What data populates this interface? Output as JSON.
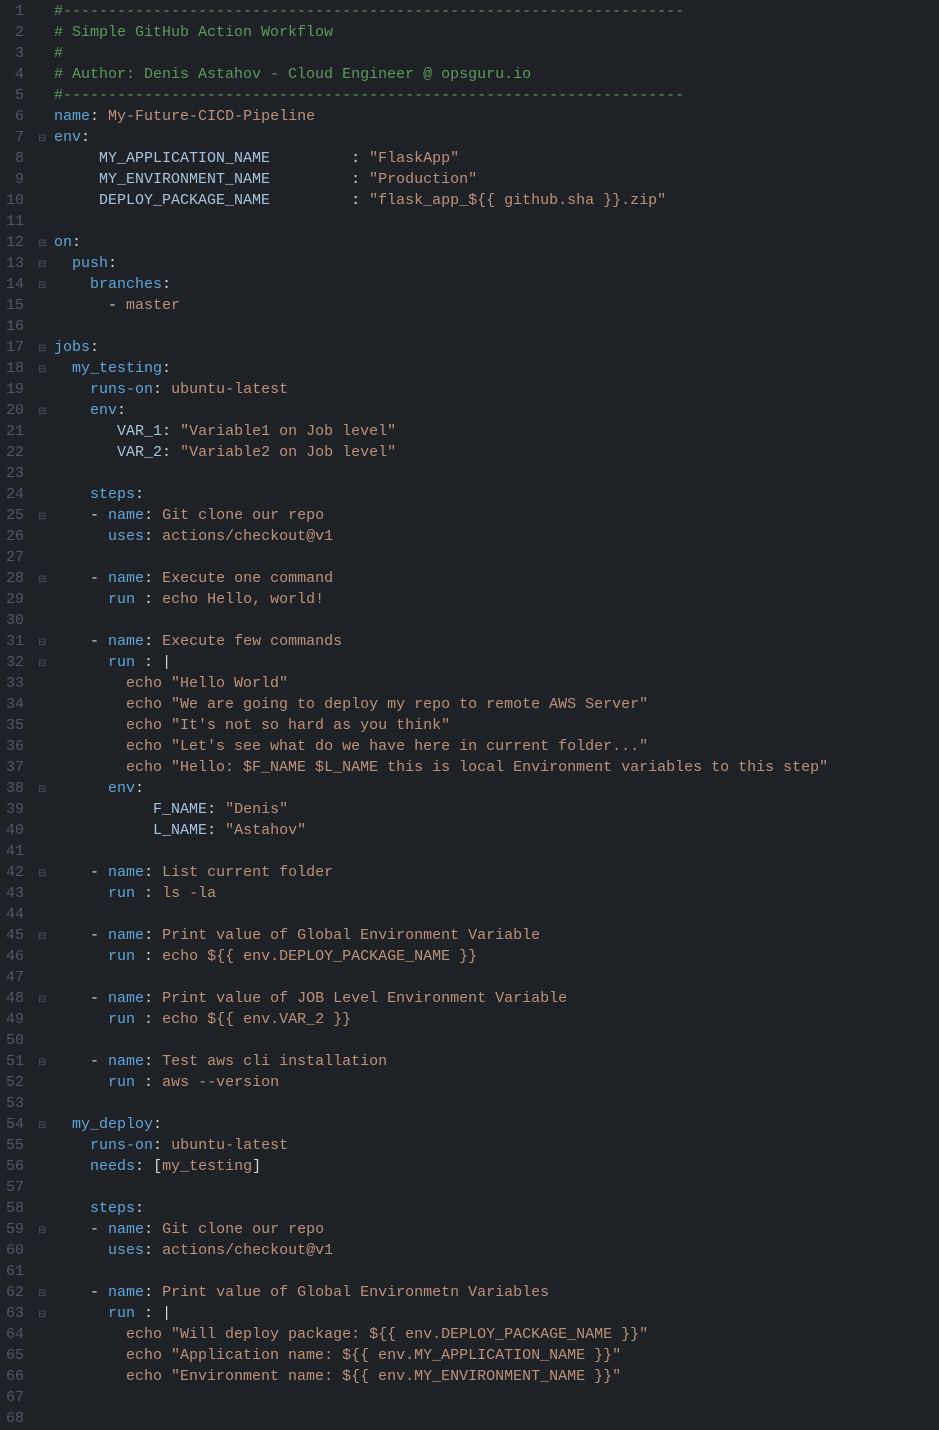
{
  "lines": [
    {
      "n": 1,
      "fold": "",
      "tokens": [
        [
          "c-comment",
          "#---------------------------------------------------------------------"
        ]
      ]
    },
    {
      "n": 2,
      "fold": "",
      "tokens": [
        [
          "c-comment",
          "# Simple GitHub Action Workflow"
        ]
      ]
    },
    {
      "n": 3,
      "fold": "",
      "tokens": [
        [
          "c-comment",
          "#"
        ]
      ]
    },
    {
      "n": 4,
      "fold": "",
      "tokens": [
        [
          "c-comment",
          "# Author: Denis Astahov - Cloud Engineer @ opsguru.io"
        ]
      ]
    },
    {
      "n": 5,
      "fold": "",
      "tokens": [
        [
          "c-comment",
          "#---------------------------------------------------------------------"
        ]
      ]
    },
    {
      "n": 6,
      "fold": "",
      "tokens": [
        [
          "c-keywd",
          "name"
        ],
        [
          "c-op",
          ": "
        ],
        [
          "c-string",
          "My-Future-CICD-Pipeline"
        ]
      ]
    },
    {
      "n": 7,
      "fold": "⊟",
      "tokens": [
        [
          "c-keywd",
          "env"
        ],
        [
          "c-op",
          ":"
        ]
      ]
    },
    {
      "n": 8,
      "fold": "",
      "tokens": [
        [
          "",
          "     "
        ],
        [
          "c-ident",
          "MY_APPLICATION_NAME"
        ],
        [
          "",
          "         "
        ],
        [
          "c-op",
          ": "
        ],
        [
          "c-string",
          "\"FlaskApp\""
        ]
      ]
    },
    {
      "n": 9,
      "fold": "",
      "tokens": [
        [
          "",
          "     "
        ],
        [
          "c-ident",
          "MY_ENVIRONMENT_NAME"
        ],
        [
          "",
          "         "
        ],
        [
          "c-op",
          ": "
        ],
        [
          "c-string",
          "\"Production\""
        ]
      ]
    },
    {
      "n": 10,
      "fold": "",
      "tokens": [
        [
          "",
          "     "
        ],
        [
          "c-ident",
          "DEPLOY_PACKAGE_NAME"
        ],
        [
          "",
          "         "
        ],
        [
          "c-op",
          ": "
        ],
        [
          "c-string",
          "\"flask_app_${{ github.sha }}.zip\""
        ]
      ]
    },
    {
      "n": 11,
      "fold": "",
      "tokens": []
    },
    {
      "n": 12,
      "fold": "⊟",
      "tokens": [
        [
          "c-keywd",
          "on"
        ],
        [
          "c-op",
          ":"
        ]
      ]
    },
    {
      "n": 13,
      "fold": "⊟",
      "tokens": [
        [
          "",
          "  "
        ],
        [
          "c-keywd",
          "push"
        ],
        [
          "c-op",
          ":"
        ]
      ]
    },
    {
      "n": 14,
      "fold": "⊟",
      "tokens": [
        [
          "",
          "    "
        ],
        [
          "c-keywd",
          "branches"
        ],
        [
          "c-op",
          ":"
        ]
      ]
    },
    {
      "n": 15,
      "fold": "",
      "tokens": [
        [
          "",
          "      "
        ],
        [
          "c-dash",
          "- "
        ],
        [
          "c-string",
          "master"
        ]
      ]
    },
    {
      "n": 16,
      "fold": "",
      "tokens": []
    },
    {
      "n": 17,
      "fold": "⊟",
      "tokens": [
        [
          "c-keywd",
          "jobs"
        ],
        [
          "c-op",
          ":"
        ]
      ]
    },
    {
      "n": 18,
      "fold": "⊟",
      "tokens": [
        [
          "",
          "  "
        ],
        [
          "c-keywd",
          "my_testing"
        ],
        [
          "c-op",
          ":"
        ]
      ]
    },
    {
      "n": 19,
      "fold": "",
      "tokens": [
        [
          "",
          "    "
        ],
        [
          "c-keywd",
          "runs-on"
        ],
        [
          "c-op",
          ": "
        ],
        [
          "c-string",
          "ubuntu-latest"
        ]
      ]
    },
    {
      "n": 20,
      "fold": "⊟",
      "tokens": [
        [
          "",
          "    "
        ],
        [
          "c-keywd",
          "env"
        ],
        [
          "c-op",
          ":"
        ]
      ]
    },
    {
      "n": 21,
      "fold": "",
      "tokens": [
        [
          "",
          "       "
        ],
        [
          "c-ident",
          "VAR_1"
        ],
        [
          "c-op",
          ": "
        ],
        [
          "c-string",
          "\"Variable1 on Job level\""
        ]
      ]
    },
    {
      "n": 22,
      "fold": "",
      "tokens": [
        [
          "",
          "       "
        ],
        [
          "c-ident",
          "VAR_2"
        ],
        [
          "c-op",
          ": "
        ],
        [
          "c-string",
          "\"Variable2 on Job level\""
        ]
      ]
    },
    {
      "n": 23,
      "fold": "",
      "tokens": []
    },
    {
      "n": 24,
      "fold": "",
      "tokens": [
        [
          "",
          "    "
        ],
        [
          "c-keywd",
          "steps"
        ],
        [
          "c-op",
          ":"
        ]
      ]
    },
    {
      "n": 25,
      "fold": "⊟",
      "tokens": [
        [
          "",
          "    "
        ],
        [
          "c-dash",
          "- "
        ],
        [
          "c-keywd",
          "name"
        ],
        [
          "c-op",
          ": "
        ],
        [
          "c-string",
          "Git clone our repo"
        ]
      ]
    },
    {
      "n": 26,
      "fold": "",
      "tokens": [
        [
          "",
          "      "
        ],
        [
          "c-keywd",
          "uses"
        ],
        [
          "c-op",
          ": "
        ],
        [
          "c-string",
          "actions/checkout@v1"
        ]
      ]
    },
    {
      "n": 27,
      "fold": "",
      "tokens": []
    },
    {
      "n": 28,
      "fold": "⊟",
      "tokens": [
        [
          "",
          "    "
        ],
        [
          "c-dash",
          "- "
        ],
        [
          "c-keywd",
          "name"
        ],
        [
          "c-op",
          ": "
        ],
        [
          "c-string",
          "Execute one command"
        ]
      ]
    },
    {
      "n": 29,
      "fold": "",
      "tokens": [
        [
          "",
          "      "
        ],
        [
          "c-keywd",
          "run "
        ],
        [
          "c-op",
          ": "
        ],
        [
          "c-string",
          "echo Hello, world!"
        ]
      ]
    },
    {
      "n": 30,
      "fold": "",
      "tokens": []
    },
    {
      "n": 31,
      "fold": "⊟",
      "tokens": [
        [
          "",
          "    "
        ],
        [
          "c-dash",
          "- "
        ],
        [
          "c-keywd",
          "name"
        ],
        [
          "c-op",
          ": "
        ],
        [
          "c-string",
          "Execute few commands"
        ]
      ]
    },
    {
      "n": 32,
      "fold": "⊟",
      "tokens": [
        [
          "",
          "      "
        ],
        [
          "c-keywd",
          "run "
        ],
        [
          "c-op",
          ": "
        ],
        [
          "c-white",
          "|"
        ]
      ]
    },
    {
      "n": 33,
      "fold": "",
      "tokens": [
        [
          "",
          "        "
        ],
        [
          "c-string",
          "echo \"Hello World\""
        ]
      ]
    },
    {
      "n": 34,
      "fold": "",
      "tokens": [
        [
          "",
          "        "
        ],
        [
          "c-string",
          "echo \"We are going to deploy my repo to remote AWS Server\""
        ]
      ]
    },
    {
      "n": 35,
      "fold": "",
      "tokens": [
        [
          "",
          "        "
        ],
        [
          "c-string",
          "echo \"It's not so hard as you think\""
        ]
      ]
    },
    {
      "n": 36,
      "fold": "",
      "tokens": [
        [
          "",
          "        "
        ],
        [
          "c-string",
          "echo \"Let's see what do we have here in current folder...\""
        ]
      ]
    },
    {
      "n": 37,
      "fold": "",
      "tokens": [
        [
          "",
          "        "
        ],
        [
          "c-string",
          "echo \"Hello: $F_NAME $L_NAME this is local Environment variables to this step\""
        ]
      ]
    },
    {
      "n": 38,
      "fold": "⊟",
      "tokens": [
        [
          "",
          "      "
        ],
        [
          "c-keywd",
          "env"
        ],
        [
          "c-op",
          ":"
        ]
      ]
    },
    {
      "n": 39,
      "fold": "",
      "tokens": [
        [
          "",
          "           "
        ],
        [
          "c-ident",
          "F_NAME"
        ],
        [
          "c-op",
          ": "
        ],
        [
          "c-string",
          "\"Denis\""
        ]
      ]
    },
    {
      "n": 40,
      "fold": "",
      "tokens": [
        [
          "",
          "           "
        ],
        [
          "c-ident",
          "L_NAME"
        ],
        [
          "c-op",
          ": "
        ],
        [
          "c-string",
          "\"Astahov\""
        ]
      ]
    },
    {
      "n": 41,
      "fold": "",
      "tokens": []
    },
    {
      "n": 42,
      "fold": "⊟",
      "tokens": [
        [
          "",
          "    "
        ],
        [
          "c-dash",
          "- "
        ],
        [
          "c-keywd",
          "name"
        ],
        [
          "c-op",
          ": "
        ],
        [
          "c-string",
          "List current folder"
        ]
      ]
    },
    {
      "n": 43,
      "fold": "",
      "tokens": [
        [
          "",
          "      "
        ],
        [
          "c-keywd",
          "run "
        ],
        [
          "c-op",
          ": "
        ],
        [
          "c-string",
          "ls -la"
        ]
      ]
    },
    {
      "n": 44,
      "fold": "",
      "tokens": []
    },
    {
      "n": 45,
      "fold": "⊟",
      "tokens": [
        [
          "",
          "    "
        ],
        [
          "c-dash",
          "- "
        ],
        [
          "c-keywd",
          "name"
        ],
        [
          "c-op",
          ": "
        ],
        [
          "c-string",
          "Print value of Global Environment Variable"
        ]
      ]
    },
    {
      "n": 46,
      "fold": "",
      "tokens": [
        [
          "",
          "      "
        ],
        [
          "c-keywd",
          "run "
        ],
        [
          "c-op",
          ": "
        ],
        [
          "c-string",
          "echo ${{ env.DEPLOY_PACKAGE_NAME }}"
        ]
      ]
    },
    {
      "n": 47,
      "fold": "",
      "tokens": []
    },
    {
      "n": 48,
      "fold": "⊟",
      "tokens": [
        [
          "",
          "    "
        ],
        [
          "c-dash",
          "- "
        ],
        [
          "c-keywd",
          "name"
        ],
        [
          "c-op",
          ": "
        ],
        [
          "c-string",
          "Print value of JOB Level Environment Variable"
        ]
      ]
    },
    {
      "n": 49,
      "fold": "",
      "tokens": [
        [
          "",
          "      "
        ],
        [
          "c-keywd",
          "run "
        ],
        [
          "c-op",
          ": "
        ],
        [
          "c-string",
          "echo ${{ env.VAR_2 }}"
        ]
      ]
    },
    {
      "n": 50,
      "fold": "",
      "tokens": []
    },
    {
      "n": 51,
      "fold": "⊟",
      "tokens": [
        [
          "",
          "    "
        ],
        [
          "c-dash",
          "- "
        ],
        [
          "c-keywd",
          "name"
        ],
        [
          "c-op",
          ": "
        ],
        [
          "c-string",
          "Test aws cli installation"
        ]
      ]
    },
    {
      "n": 52,
      "fold": "",
      "tokens": [
        [
          "",
          "      "
        ],
        [
          "c-keywd",
          "run "
        ],
        [
          "c-op",
          ": "
        ],
        [
          "c-string",
          "aws --version"
        ]
      ]
    },
    {
      "n": 53,
      "fold": "",
      "tokens": []
    },
    {
      "n": 54,
      "fold": "⊟",
      "tokens": [
        [
          "",
          "  "
        ],
        [
          "c-keywd",
          "my_deploy"
        ],
        [
          "c-op",
          ":"
        ]
      ]
    },
    {
      "n": 55,
      "fold": "",
      "tokens": [
        [
          "",
          "    "
        ],
        [
          "c-keywd",
          "runs-on"
        ],
        [
          "c-op",
          ": "
        ],
        [
          "c-string",
          "ubuntu-latest"
        ]
      ]
    },
    {
      "n": 56,
      "fold": "",
      "tokens": [
        [
          "",
          "    "
        ],
        [
          "c-keywd",
          "needs"
        ],
        [
          "c-op",
          ": "
        ],
        [
          "c-white",
          "["
        ],
        [
          "c-string",
          "my_testing"
        ],
        [
          "c-white",
          "]"
        ]
      ]
    },
    {
      "n": 57,
      "fold": "",
      "tokens": []
    },
    {
      "n": 58,
      "fold": "",
      "tokens": [
        [
          "",
          "    "
        ],
        [
          "c-keywd",
          "steps"
        ],
        [
          "c-op",
          ":"
        ]
      ]
    },
    {
      "n": 59,
      "fold": "⊟",
      "tokens": [
        [
          "",
          "    "
        ],
        [
          "c-dash",
          "- "
        ],
        [
          "c-keywd",
          "name"
        ],
        [
          "c-op",
          ": "
        ],
        [
          "c-string",
          "Git clone our repo"
        ]
      ]
    },
    {
      "n": 60,
      "fold": "",
      "tokens": [
        [
          "",
          "      "
        ],
        [
          "c-keywd",
          "uses"
        ],
        [
          "c-op",
          ": "
        ],
        [
          "c-string",
          "actions/checkout@v1"
        ]
      ]
    },
    {
      "n": 61,
      "fold": "",
      "tokens": []
    },
    {
      "n": 62,
      "fold": "⊟",
      "tokens": [
        [
          "",
          "    "
        ],
        [
          "c-dash",
          "- "
        ],
        [
          "c-keywd",
          "name"
        ],
        [
          "c-op",
          ": "
        ],
        [
          "c-string",
          "Print value of Global Environmetn Variables"
        ]
      ]
    },
    {
      "n": 63,
      "fold": "⊟",
      "tokens": [
        [
          "",
          "      "
        ],
        [
          "c-keywd",
          "run "
        ],
        [
          "c-op",
          ": "
        ],
        [
          "c-white",
          "|"
        ]
      ]
    },
    {
      "n": 64,
      "fold": "",
      "tokens": [
        [
          "",
          "        "
        ],
        [
          "c-string",
          "echo \"Will deploy package: ${{ env.DEPLOY_PACKAGE_NAME }}\""
        ]
      ]
    },
    {
      "n": 65,
      "fold": "",
      "tokens": [
        [
          "",
          "        "
        ],
        [
          "c-string",
          "echo \"Application name: ${{ env.MY_APPLICATION_NAME }}\""
        ]
      ]
    },
    {
      "n": 66,
      "fold": "",
      "tokens": [
        [
          "",
          "        "
        ],
        [
          "c-string",
          "echo \"Environment name: ${{ env.MY_ENVIRONMENT_NAME }}\""
        ]
      ]
    },
    {
      "n": 67,
      "fold": "",
      "tokens": []
    },
    {
      "n": 68,
      "fold": "",
      "tokens": []
    }
  ]
}
